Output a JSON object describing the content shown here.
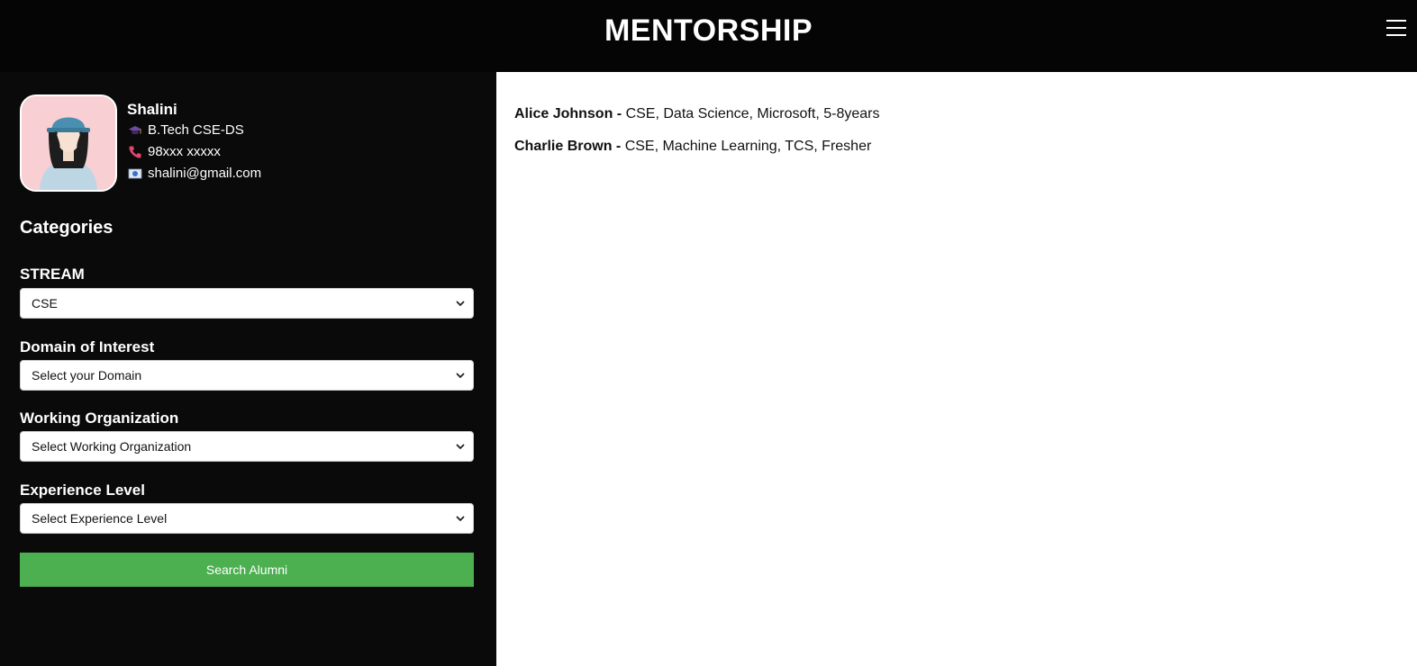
{
  "header": {
    "title": "MENTORSHIP",
    "menu_icon": "hamburger-menu-icon"
  },
  "profile": {
    "name": "Shalini",
    "degree": "B.Tech CSE-DS",
    "phone": "98xxx xxxxx",
    "email": "shalini@gmail.com",
    "icons": [
      "graduation-cap-icon",
      "phone-icon",
      "email-icon"
    ]
  },
  "filters": {
    "title": "Categories",
    "stream": {
      "label": "STREAM",
      "value": "CSE"
    },
    "domain": {
      "label": "Domain of Interest",
      "value": "Select your Domain"
    },
    "organization": {
      "label": "Working Organization",
      "value": "Select Working Organization"
    },
    "experience": {
      "label": "Experience Level",
      "value": "Select Experience Level"
    },
    "search_button": "Search Alumni"
  },
  "results": [
    {
      "name": "Alice Johnson -",
      "details": "CSE, Data Science, Microsoft, 5-8years"
    },
    {
      "name": "Charlie Brown -",
      "details": "CSE, Machine Learning, TCS, Fresher"
    }
  ],
  "colors": {
    "accent": "#4caf50",
    "background": "#0a0a0a"
  }
}
